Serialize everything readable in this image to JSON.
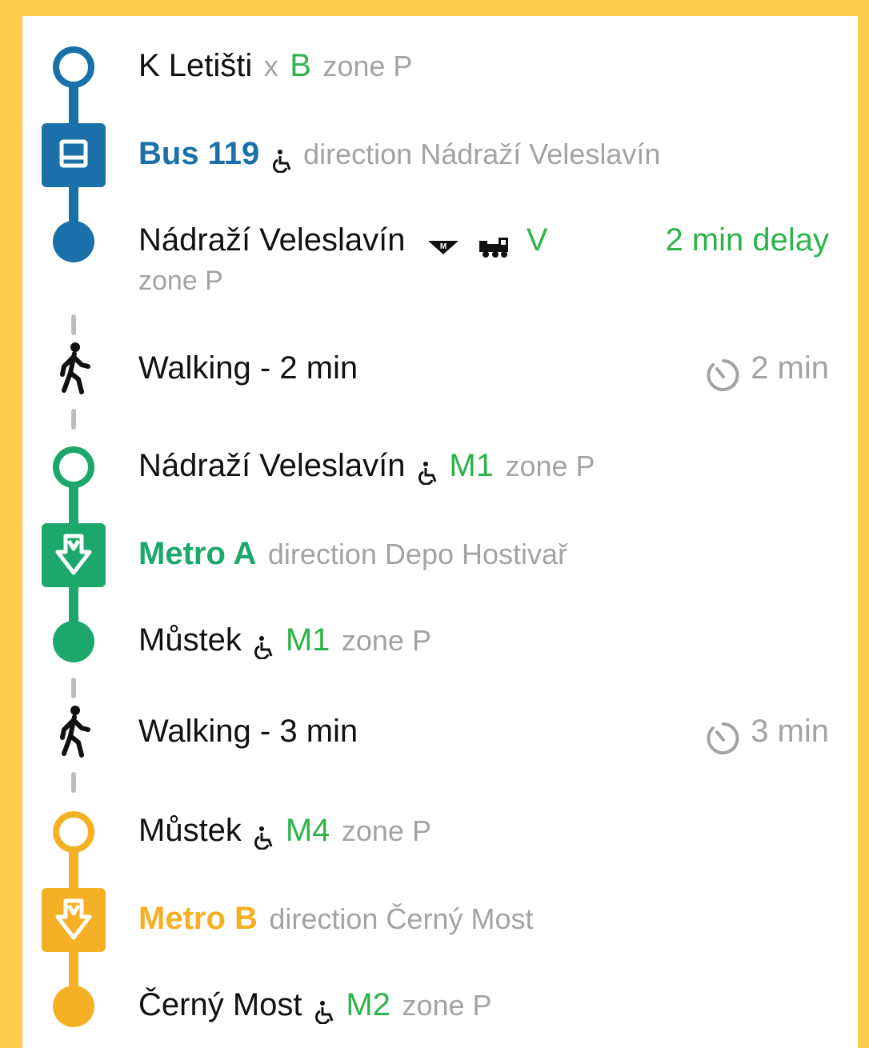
{
  "colors": {
    "background": "#FFCC4D",
    "bus": "#1A70A8",
    "metro_a": "#1CA86A",
    "metro_b": "#F5B025",
    "accent_green": "#2DB34A",
    "secondary_text": "#A3A3A3"
  },
  "segments": [
    {
      "type": "transit",
      "color_key": "bus",
      "icon": "bus-icon",
      "start": {
        "name": "K Letišti",
        "separator": "x",
        "line_code": "B",
        "zone": "zone P"
      },
      "line": {
        "label": "Bus 119",
        "wheelchair_icon": "wheelchair-icon",
        "direction": "direction Nádraží Veleslavín"
      },
      "end": {
        "name": "Nádraží Veleslavín",
        "metro_icon": "metro-logo-icon",
        "train_icon": "train-icon",
        "line_code": "V",
        "delay": "2 min delay",
        "zone": "zone P"
      }
    },
    {
      "type": "walk",
      "icon": "walking-person-icon",
      "label": "Walking - 2 min",
      "duration": "2 min",
      "timer_icon": "timer-icon"
    },
    {
      "type": "transit",
      "color_key": "metro_a",
      "icon": "metro-icon",
      "start": {
        "name": "Nádraží Veleslavín",
        "wheelchair_icon": "wheelchair-icon",
        "line_code": "M1",
        "zone": "zone P"
      },
      "line": {
        "label": "Metro A",
        "direction": "direction Depo Hostivař"
      },
      "end": {
        "name": "Můstek",
        "wheelchair_icon": "wheelchair-icon",
        "line_code": "M1",
        "zone": "zone P"
      }
    },
    {
      "type": "walk",
      "icon": "walking-person-icon",
      "label": "Walking - 3 min",
      "duration": "3 min",
      "timer_icon": "timer-icon"
    },
    {
      "type": "transit",
      "color_key": "metro_b",
      "icon": "metro-icon",
      "start": {
        "name": "Můstek",
        "wheelchair_icon": "wheelchair-icon",
        "line_code": "M4",
        "zone": "zone P"
      },
      "line": {
        "label": "Metro B",
        "direction": "direction Černý Most"
      },
      "end": {
        "name": "Černý Most",
        "wheelchair_icon": "wheelchair-icon",
        "line_code": "M2",
        "zone": "zone P"
      }
    }
  ]
}
